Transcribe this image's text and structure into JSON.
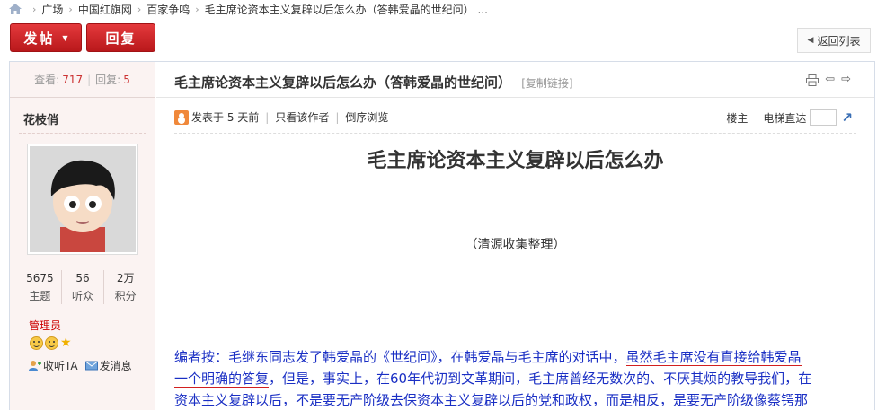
{
  "breadcrumb": {
    "items": [
      "广场",
      "中国红旗网",
      "百家争鸣",
      "毛主席论资本主义复辟以后怎么办（答韩爱晶的世纪问） ..."
    ]
  },
  "toolbar": {
    "post_label": "发帖",
    "reply_label": "回复",
    "back_label": "返回列表"
  },
  "sidebar": {
    "views_label": "查看:",
    "views": "717",
    "replies_label": "回复:",
    "replies": "5",
    "author": "花枝俏",
    "counts": [
      {
        "value": "5675",
        "label": "主题"
      },
      {
        "value": "56",
        "label": "听众"
      },
      {
        "value": "2万",
        "label": "积分"
      }
    ],
    "role": "管理员",
    "follow_label": "收听TA",
    "message_label": "发消息"
  },
  "post": {
    "title": "毛主席论资本主义复辟以后怎么办（答韩爱晶的世纪问）",
    "copy_link": "[复制链接]",
    "posted_prefix": "发表于",
    "posted_time": "5 天前",
    "only_author": "只看该作者",
    "reverse_view": "倒序浏览",
    "floor": "楼主",
    "elevator": "电梯直达",
    "heading": "毛主席论资本主义复辟以后怎么办",
    "subheading": "（清源收集整理）",
    "body_lines": [
      {
        "a": "编者按：毛继东同志发了韩爱晶的《世纪问》，在韩爱晶与毛主席的对话中，",
        "u": "虽然毛主席没有直接给韩爱晶"
      },
      {
        "u": "一个明确的答复",
        "a": "，但是，事实上，在60年代初到文革期间，毛主席曾经无数次的、不厌其烦的教导我们，在"
      },
      {
        "a": "资本主义复辟以后，不是要无产阶级去保资本主义复辟以后的党和政权，而是相反，是要无产阶级像蔡锷那"
      }
    ]
  }
}
